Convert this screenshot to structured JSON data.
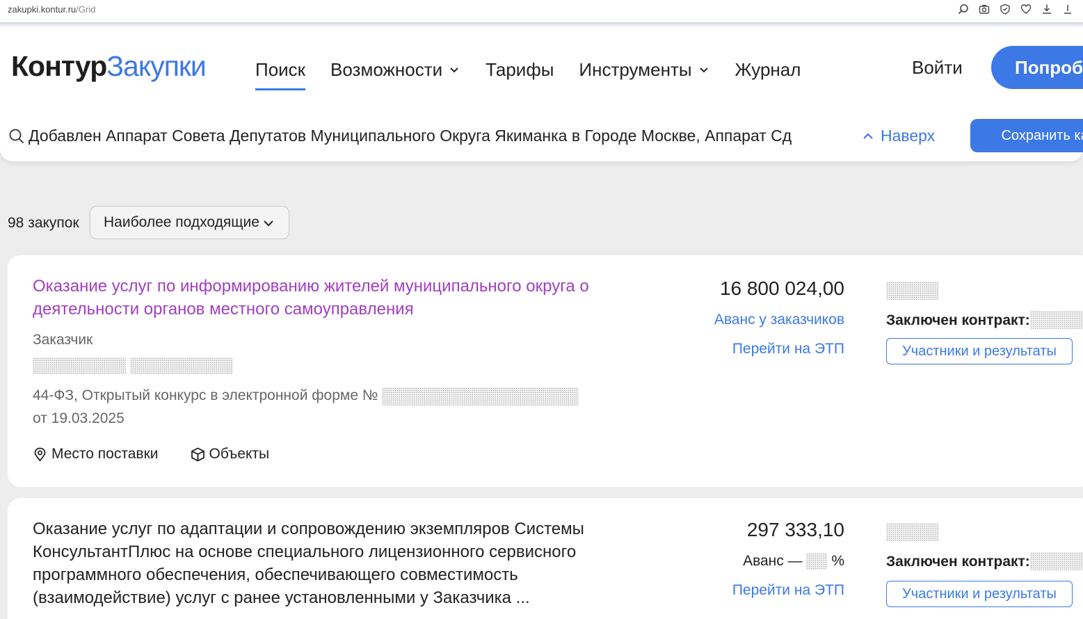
{
  "browser": {
    "url_host": "zakupki.kontur.ru",
    "url_path": "/Grid"
  },
  "header": {
    "logo_brand": "Контур",
    "logo_product": "Закупки",
    "nav": [
      {
        "label": "Поиск",
        "active": true
      },
      {
        "label": "Возможности",
        "dropdown": true
      },
      {
        "label": "Тарифы"
      },
      {
        "label": "Инструменты",
        "dropdown": true
      },
      {
        "label": "Журнал"
      }
    ],
    "login_label": "Войти",
    "try_label": "Попробовать"
  },
  "search": {
    "query": "Добавлен Аппарат Совета Депутатов Муниципального Округа Якиманка в Городе Москве, Аппарат Сд",
    "up_label": "Наверх",
    "save_label": "Сохранить как"
  },
  "results": {
    "count_label": "98 закупок",
    "sort_label": "Наиболее подходящие"
  },
  "cards": [
    {
      "title": "Оказание услуг по информированию жителей муниципального округа о деятельности органов местного самоуправления",
      "customer_label": "Заказчик",
      "law_line": "44-ФЗ, Открытый конкурс в электронной форме №",
      "date_line": "от 19.03.2025",
      "place_label": "Место поставки",
      "objects_label": "Объекты",
      "price": "16 800 024,00",
      "advance": "Аванс у заказчиков",
      "etp_link": "Перейти на ЭТП",
      "contract_label": "Заключен контракт:",
      "participants_label": "Участники и результаты"
    },
    {
      "title": "Оказание услуг по адаптации и сопровождению экземпляров Системы КонсультантПлюс на основе специального лицензионного сервисного программного обеспечения, обеспечивающего совместимость (взаимодействие) услуг с ранее установленными у Заказчика ...",
      "price": "297 333,10",
      "advance_prefix": "Аванс —",
      "advance_suffix": "%",
      "etp_link": "Перейти на ЭТП",
      "contract_label": "Заключен контракт:",
      "participants_label": "Участники и результаты"
    }
  ],
  "colors": {
    "accent": "#3c78e6",
    "visited_link": "#a040c0"
  }
}
